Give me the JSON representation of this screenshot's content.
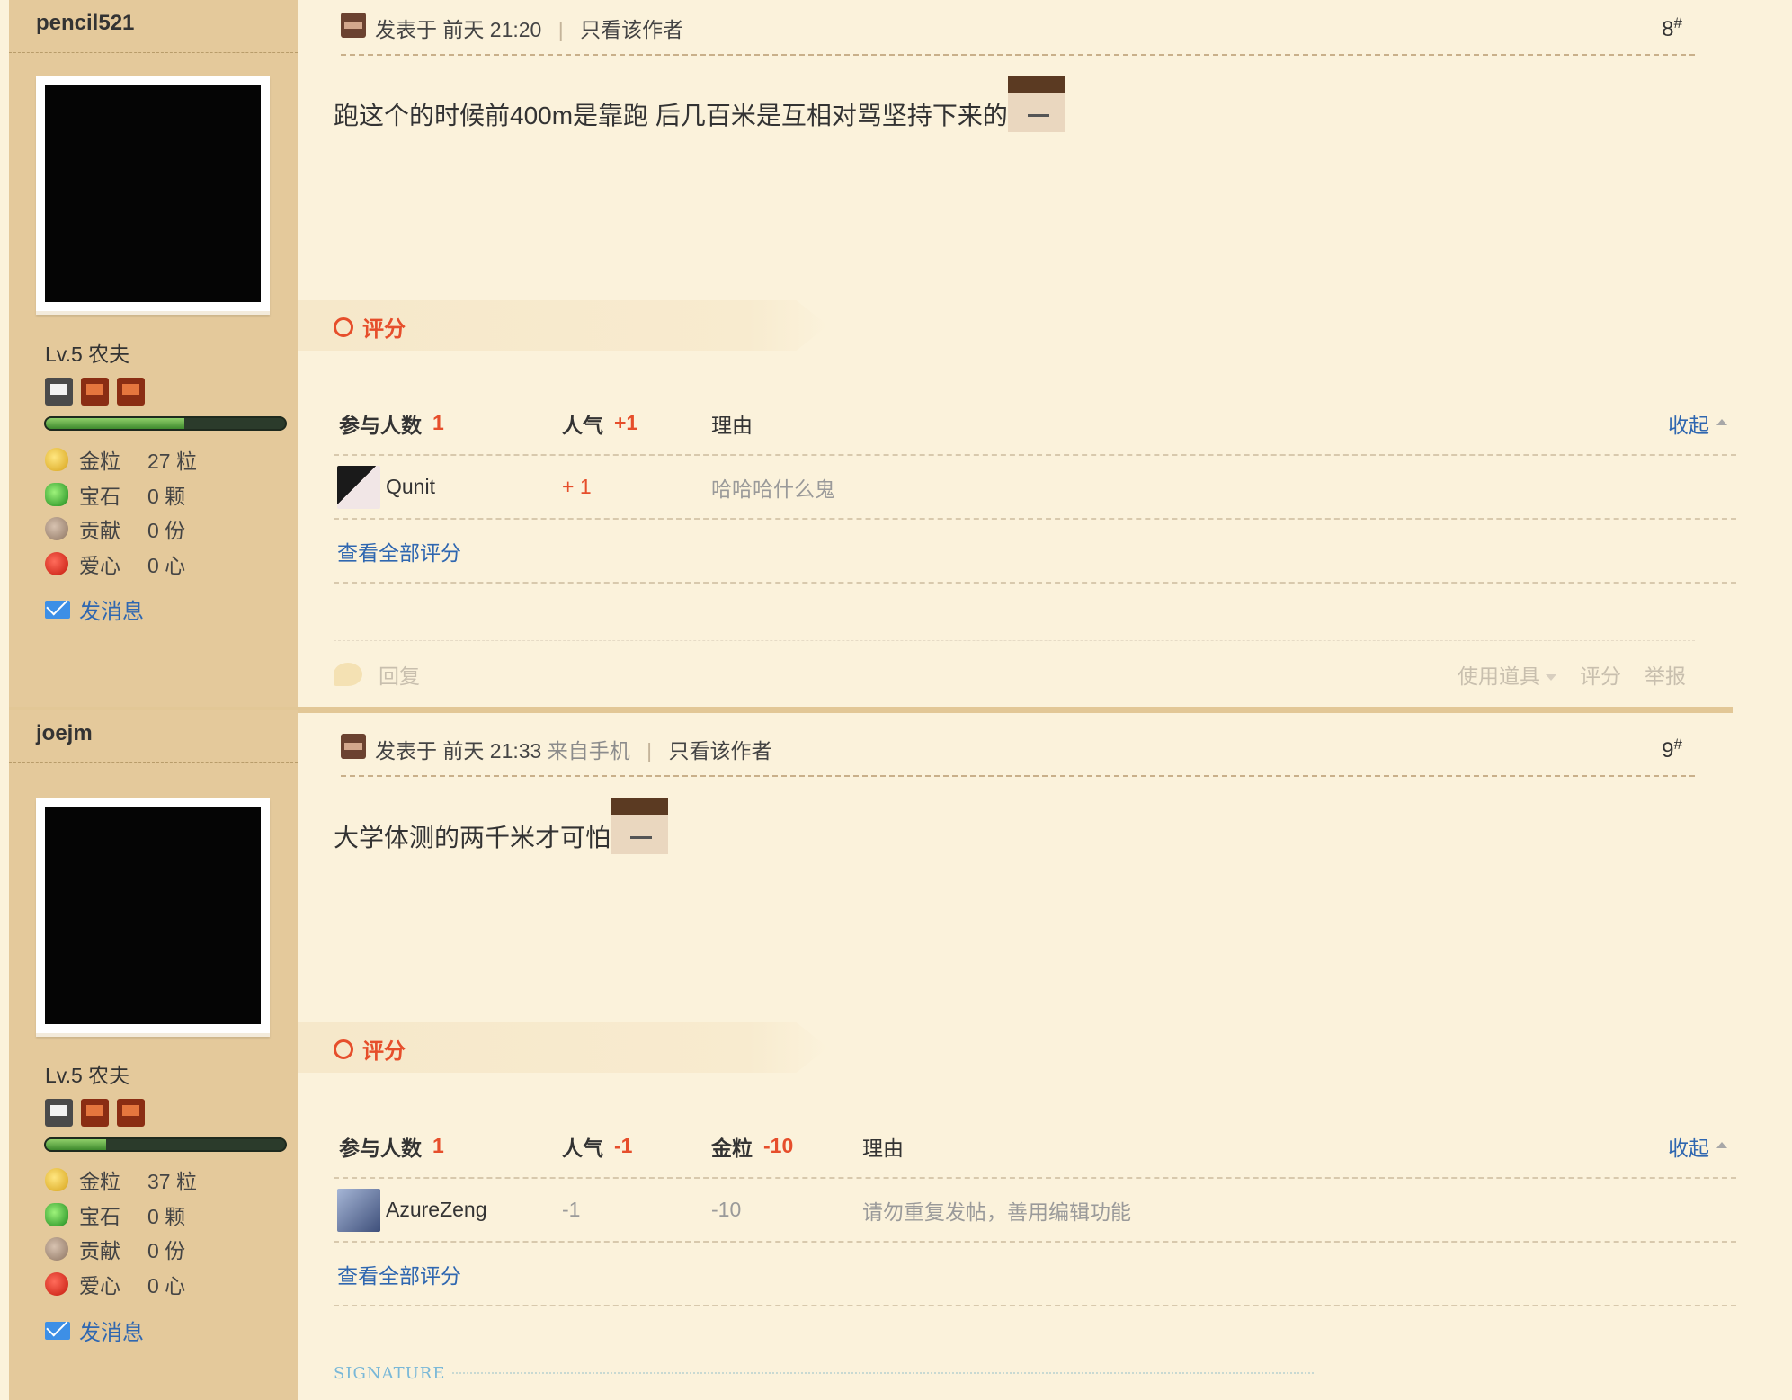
{
  "posts": [
    {
      "author": "pencil521",
      "level": "Lv.5 农夫",
      "stats": [
        {
          "icon": "gold-icon",
          "label": "金粒",
          "value": "27 粒"
        },
        {
          "icon": "gem-icon",
          "label": "宝石",
          "value": "0 颗"
        },
        {
          "icon": "contribution-icon",
          "label": "贡献",
          "value": "0 份"
        },
        {
          "icon": "heart-icon",
          "label": "爱心",
          "value": "0 心"
        }
      ],
      "xp_fraction": 0.58,
      "send_message": "发消息",
      "posted_label": "发表于",
      "posted_time": "前天 21:20",
      "from": "",
      "only_author": "只看该作者",
      "floor": "8",
      "floor_mark": "#",
      "content": "跑这个的时候前400m是靠跑 后几百米是互相对骂坚持下来的",
      "rating": {
        "title": "评分",
        "participants_label": "参与人数",
        "participants": "1",
        "columns": [
          {
            "label": "人气",
            "value": "+1"
          }
        ],
        "reason_label": "理由",
        "collapse": "收起",
        "rows": [
          {
            "user": "Qunit",
            "values": [
              "+ 1"
            ],
            "reason": "哈哈哈什么鬼"
          }
        ],
        "view_all": "查看全部评分"
      },
      "footer": {
        "reply": "回复",
        "use_item": "使用道具",
        "rate": "评分",
        "report": "举报"
      }
    },
    {
      "author": "joejm",
      "level": "Lv.5 农夫",
      "stats": [
        {
          "icon": "gold-icon",
          "label": "金粒",
          "value": "37 粒"
        },
        {
          "icon": "gem-icon",
          "label": "宝石",
          "value": "0 颗"
        },
        {
          "icon": "contribution-icon",
          "label": "贡献",
          "value": "0 份"
        },
        {
          "icon": "heart-icon",
          "label": "爱心",
          "value": "0 心"
        }
      ],
      "xp_fraction": 0.25,
      "send_message": "发消息",
      "posted_label": "发表于",
      "posted_time": "前天 21:33",
      "from": "来自手机",
      "only_author": "只看该作者",
      "floor": "9",
      "floor_mark": "#",
      "content": "大学体测的两千米才可怕",
      "rating": {
        "title": "评分",
        "participants_label": "参与人数",
        "participants": "1",
        "columns": [
          {
            "label": "人气",
            "value": "-1"
          },
          {
            "label": "金粒",
            "value": "-10"
          }
        ],
        "reason_label": "理由",
        "collapse": "收起",
        "rows": [
          {
            "user": "AzureZeng",
            "values": [
              "-1",
              "-10"
            ],
            "reason": "请勿重复发帖，善用编辑功能"
          }
        ],
        "view_all": "查看全部评分"
      },
      "signature": "SIGNATURE"
    }
  ]
}
